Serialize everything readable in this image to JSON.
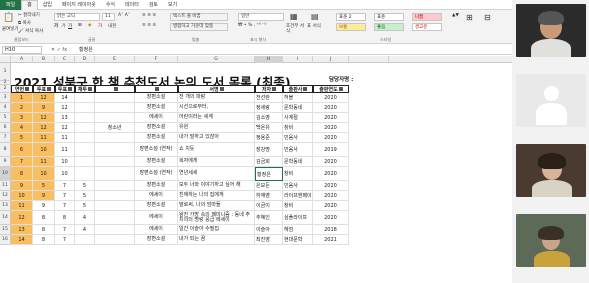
{
  "ribbon": {
    "tabs": [
      "파일",
      "홈",
      "삽입",
      "페이지 레이아웃",
      "수식",
      "데이터",
      "검토",
      "보기"
    ],
    "paste_label": "붙여넣기",
    "cut_label": "잘라내기",
    "copy_label": "복사",
    "format_painter_label": "서식 복사",
    "font_name": "맑은 고딕",
    "font_size": "11",
    "wrap_text_label": "텍스트 줄 바꿈",
    "merge_label": "병합하고 가운데 맞춤",
    "number_format": "일반",
    "conditional_format_label": "조건부 서식",
    "table_format_label": "표 서식",
    "styles": [
      "표준 2",
      "표준",
      "나쁨",
      "보통",
      "좋음",
      "경고문"
    ],
    "group_clipboard": "클립보드",
    "group_font": "글꼴",
    "group_align": "맞춤",
    "group_number": "표시 형식",
    "group_styles": "스타일"
  },
  "formula_bar": {
    "name_box": "H10",
    "fx": "✕ ✓ fx",
    "content": "황정은"
  },
  "sheet": {
    "title": "2021 성북구 한 책 추천도서 논의 도서 목록 (최종)",
    "manager_label": "담당자명 :",
    "columns": [
      "A",
      "B",
      "C",
      "D",
      "E",
      "F",
      "G",
      "H",
      "I",
      "J"
    ],
    "header": [
      "연번",
      "투표",
      "투표",
      "채투",
      "",
      "",
      "서명",
      "저자",
      "출판사",
      "출판연도"
    ],
    "rows": [
      {
        "n": "3",
        "a": "1",
        "b": "12",
        "c": "14",
        "d": "",
        "e": "",
        "f": "장편소설",
        "g": "천 개의 파랑",
        "h": "천선란",
        "i": "허블",
        "j": "2020"
      },
      {
        "n": "4",
        "a": "2",
        "b": "9",
        "c": "12",
        "d": "",
        "e": "",
        "f": "장편소설",
        "g": "시선으로부터,",
        "h": "정세랑",
        "i": "문학동네",
        "j": "2020"
      },
      {
        "n": "5",
        "a": "3",
        "b": "12",
        "c": "13",
        "d": "",
        "e": "",
        "f": "에세이",
        "g": "어린이라는 세계",
        "h": "김소영",
        "i": "사계절",
        "j": "2020"
      },
      {
        "n": "6",
        "a": "4",
        "b": "12",
        "c": "12",
        "d": "",
        "e": "청소년",
        "f": "장편소설",
        "g": "유원",
        "h": "백온유",
        "i": "창비",
        "j": "2020"
      },
      {
        "n": "7",
        "a": "5",
        "b": "11",
        "c": "11",
        "d": "",
        "e": "",
        "f": "장편소설",
        "g": "내가 말하고 있잖아",
        "h": "정용준",
        "i": "민음사",
        "j": "2020"
      },
      {
        "n": "8",
        "a": "6",
        "b": "10",
        "c": "11",
        "d": "",
        "e": "",
        "f": "장편소설\n(연작)",
        "g": "쇼 치듯",
        "h": "장강명",
        "i": "민음사",
        "j": "2019"
      },
      {
        "n": "9",
        "a": "7",
        "b": "11",
        "c": "10",
        "d": "",
        "e": "",
        "f": "장편소설",
        "g": "복자에게",
        "h": "김금희",
        "i": "문학동네",
        "j": "2020"
      },
      {
        "n": "10",
        "a": "8",
        "b": "10",
        "c": "10",
        "d": "",
        "e": "",
        "f": "장편소설\n(연작)",
        "g": "연년세세",
        "h": "황정은",
        "i": "창비",
        "j": "2020"
      },
      {
        "n": "11",
        "a": "9",
        "b": "5",
        "c": "7",
        "d": "5",
        "e": "",
        "f": "장편소설",
        "g": "모두 너와 이야기하고 싶어 해",
        "h": "은모든",
        "i": "민음사",
        "j": "2020"
      },
      {
        "n": "12",
        "a": "10",
        "b": "9",
        "c": "7",
        "d": "5",
        "e": "",
        "f": "에세이",
        "g": "친애하는 나의 집에게",
        "h": "하재영",
        "i": "라이프앤페이지",
        "j": "2020"
      },
      {
        "n": "13",
        "a": "11",
        "b": "9",
        "c": "7",
        "d": "5",
        "e": "",
        "f": "장편소설",
        "g": "말로써, 나의 엄마들",
        "h": "이금이",
        "i": "창비",
        "j": "2020"
      },
      {
        "n": "14",
        "a": "12",
        "b": "8",
        "c": "8",
        "d": "4",
        "e": "",
        "f": "에세이",
        "g": "왕진 가방 속의 페미니즘 : 동네 주치의의 명랑 응급 에세이",
        "h": "추혜인",
        "i": "심플라이프",
        "j": "2020"
      },
      {
        "n": "15",
        "a": "13",
        "b": "8",
        "c": "7",
        "d": "4",
        "e": "",
        "f": "에세이",
        "g": "일간 이슬아 수필집",
        "h": "이슬아",
        "i": "헤엄",
        "j": "2018"
      },
      {
        "n": "16",
        "a": "14",
        "b": "8",
        "c": "7",
        "d": "",
        "e": "",
        "f": "장편소설",
        "g": "내가 되는 꿈",
        "h": "최진영",
        "i": "현대문학",
        "j": "2021"
      }
    ]
  },
  "colors": {
    "excel_green": "#217346",
    "highlight_orange": "#f9be60",
    "bad_style": "#ffc7ce",
    "good_style": "#c6efce",
    "neutral_style": "#ffeb9c"
  }
}
